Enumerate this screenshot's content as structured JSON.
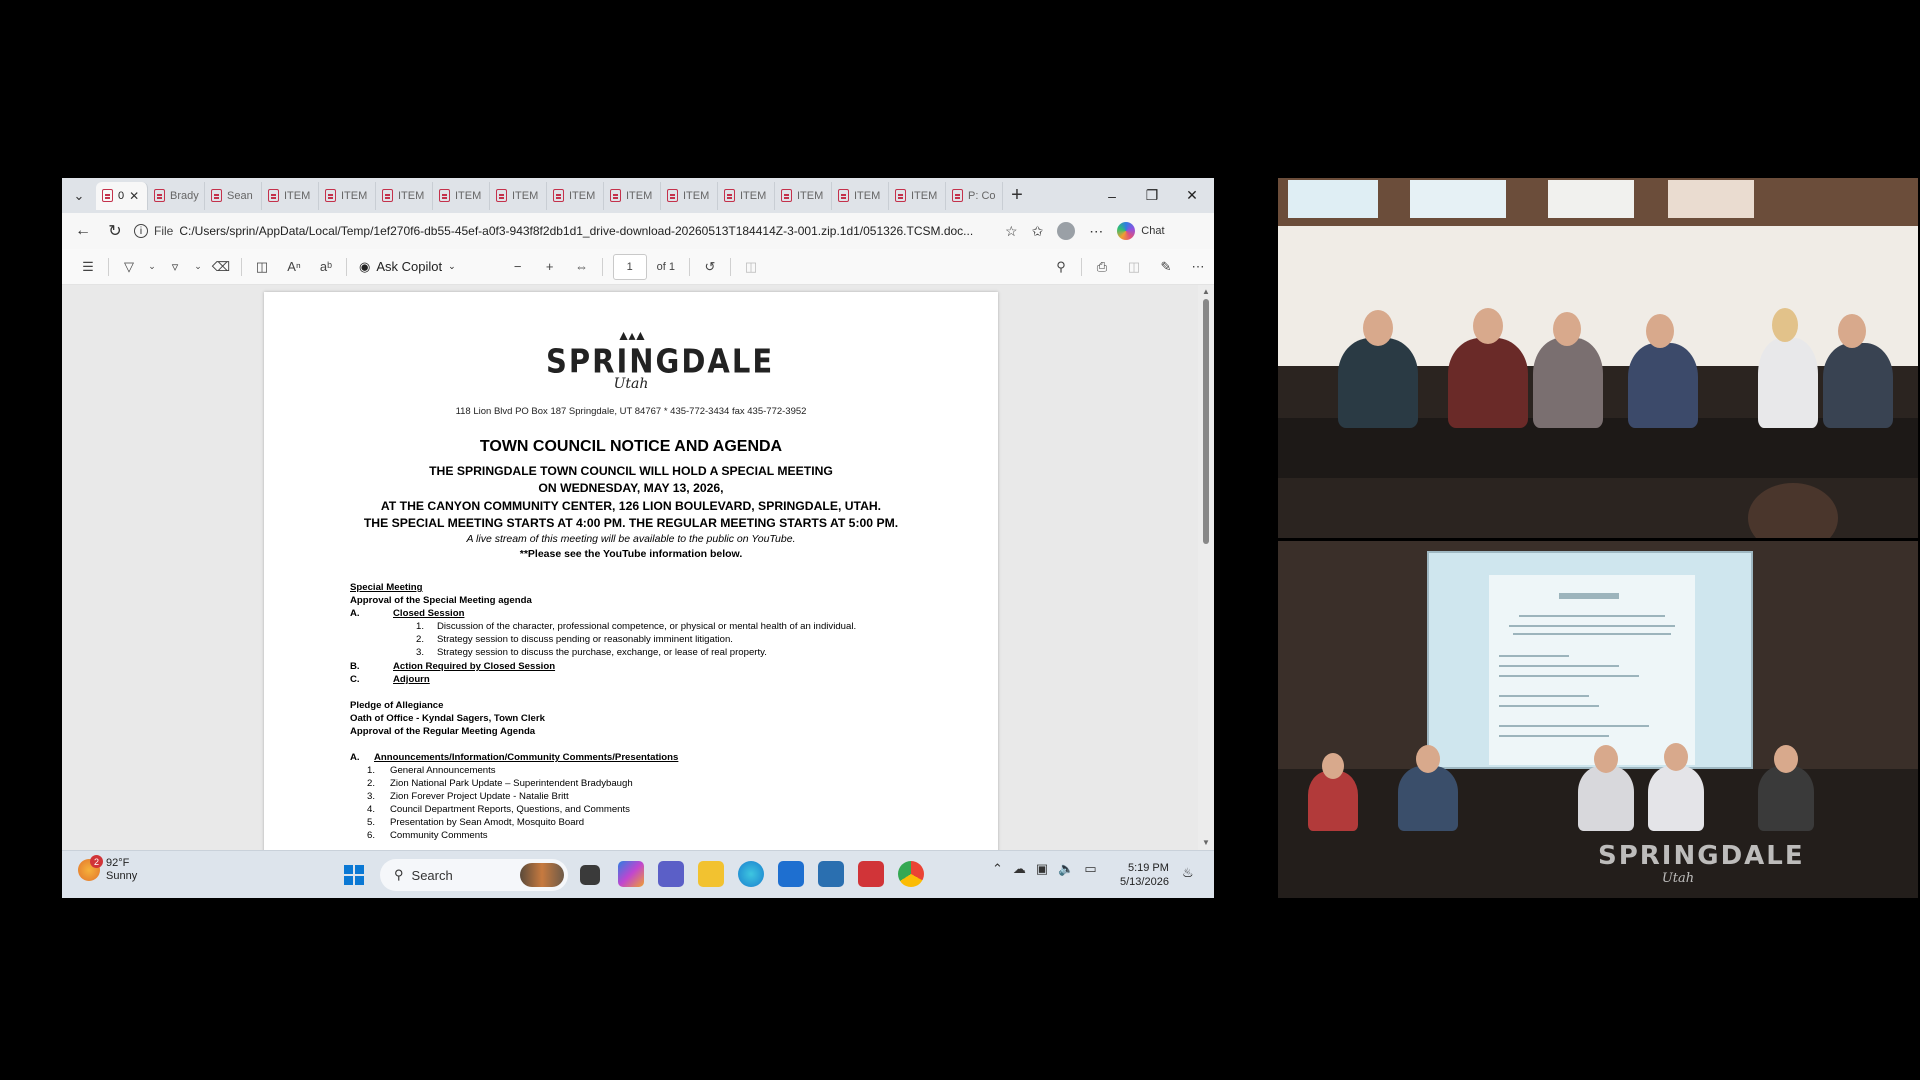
{
  "browser": {
    "active_tab_label": "0",
    "tabs": [
      "Brady",
      "Sean",
      "ITEM",
      "ITEM",
      "ITEM",
      "ITEM",
      "ITEM",
      "ITEM",
      "ITEM",
      "ITEM",
      "ITEM",
      "ITEM",
      "ITEM",
      "ITEM",
      "P: Co"
    ],
    "file_label": "File",
    "url": "C:/Users/sprin/AppData/Local/Temp/1ef270f6-db55-45ef-a0f3-943f8f2db1d1_drive-download-20260513T184414Z-3-001.zip.1d1/051326.TCSM.doc...",
    "chat_label": "Chat"
  },
  "pdf_toolbar": {
    "ask_copilot": "Ask Copilot",
    "page_number": "1",
    "page_total": "of 1"
  },
  "document": {
    "logo_word": "SPRINGDALE",
    "logo_sub": "Utah",
    "address": "118 Lion Blvd   PO Box 187   Springdale, UT 84767 * 435-772-3434    fax 435-772-3952",
    "title": "TOWN COUNCIL NOTICE AND AGENDA",
    "lines": [
      "THE SPRINGDALE TOWN COUNCIL WILL HOLD A SPECIAL MEETING",
      "ON WEDNESDAY, MAY 13, 2026,",
      "AT THE CANYON COMMUNITY CENTER, 126 LION BOULEVARD, SPRINGDALE, UTAH.",
      "THE SPECIAL MEETING STARTS AT 4:00 PM. THE REGULAR MEETING STARTS AT 5:00 PM."
    ],
    "livestream": "A live stream of this meeting will be available to the public on YouTube.",
    "youtube_note": "**Please see the YouTube information below.",
    "special_meeting": "Special Meeting",
    "approval_special": "Approval of the Special Meeting agenda",
    "section_a_letter": "A.",
    "section_a": "Closed Session",
    "closed_items": [
      "Discussion of the character, professional competence, or physical or mental health of an individual.",
      "Strategy session to discuss pending or reasonably imminent litigation.",
      "Strategy session to discuss the purchase, exchange, or lease of real property."
    ],
    "section_b_letter": "B.",
    "section_b": "Action Required by Closed Session",
    "section_c_letter": "C.",
    "section_c": "Adjourn",
    "pledge": "Pledge of Allegiance",
    "oath": "Oath of Office - Kyndal Sagers, Town Clerk",
    "approval_regular": "Approval of the Regular Meeting Agenda",
    "announce_letter": "A.",
    "announce_heading": "Announcements/Information/Community Comments/Presentations",
    "announce_items": [
      "General Announcements",
      "Zion National Park Update – Superintendent Bradybaugh",
      "Zion Forever Project Update - Natalie Britt",
      "Council Department Reports, Questions, and Comments",
      "Presentation by Sean Amodt, Mosquito Board",
      "Community Comments"
    ]
  },
  "taskbar": {
    "weather_badge": "2",
    "temp": "92°F",
    "condition": "Sunny",
    "search": "Search",
    "time": "5:19 PM",
    "date": "5/13/2026"
  },
  "camera": {
    "logo_word": "SPRINGDALE",
    "logo_sub": "Utah"
  }
}
